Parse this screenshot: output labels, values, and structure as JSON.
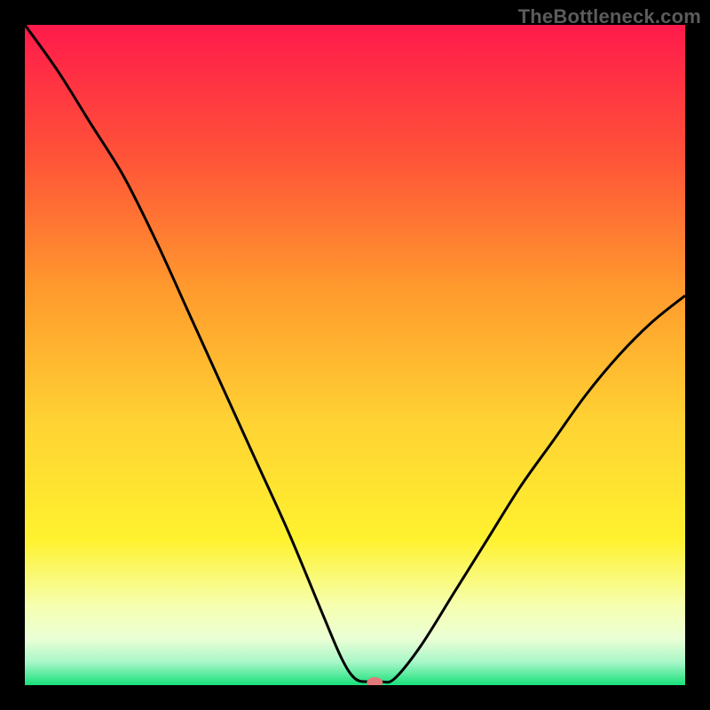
{
  "watermark": "TheBottleneck.com",
  "chart_data": {
    "type": "line",
    "title": "",
    "xlabel": "",
    "ylabel": "",
    "xlim": [
      0,
      100
    ],
    "ylim": [
      0,
      100
    ],
    "x": [
      0,
      5,
      10,
      15,
      20,
      25,
      30,
      35,
      40,
      45,
      48,
      50,
      52,
      54,
      56,
      60,
      65,
      70,
      75,
      80,
      85,
      90,
      95,
      100
    ],
    "values": [
      100,
      93,
      85,
      77,
      67,
      56,
      45,
      34,
      23,
      11,
      4,
      1,
      0.5,
      0.5,
      1,
      6,
      14,
      22,
      30,
      37,
      44,
      50,
      55,
      59
    ],
    "gradient_stops": [
      {
        "offset": 0.0,
        "color": "#ff1a4b"
      },
      {
        "offset": 0.2,
        "color": "#ff5338"
      },
      {
        "offset": 0.4,
        "color": "#ff9a2d"
      },
      {
        "offset": 0.6,
        "color": "#ffd233"
      },
      {
        "offset": 0.78,
        "color": "#fff22f"
      },
      {
        "offset": 0.88,
        "color": "#f6ffb0"
      },
      {
        "offset": 0.93,
        "color": "#eaffd5"
      },
      {
        "offset": 0.965,
        "color": "#a8f7c8"
      },
      {
        "offset": 1.0,
        "color": "#18e07a"
      }
    ],
    "marker": {
      "x": 53,
      "y": 0.4,
      "color": "#e07a7a"
    }
  }
}
